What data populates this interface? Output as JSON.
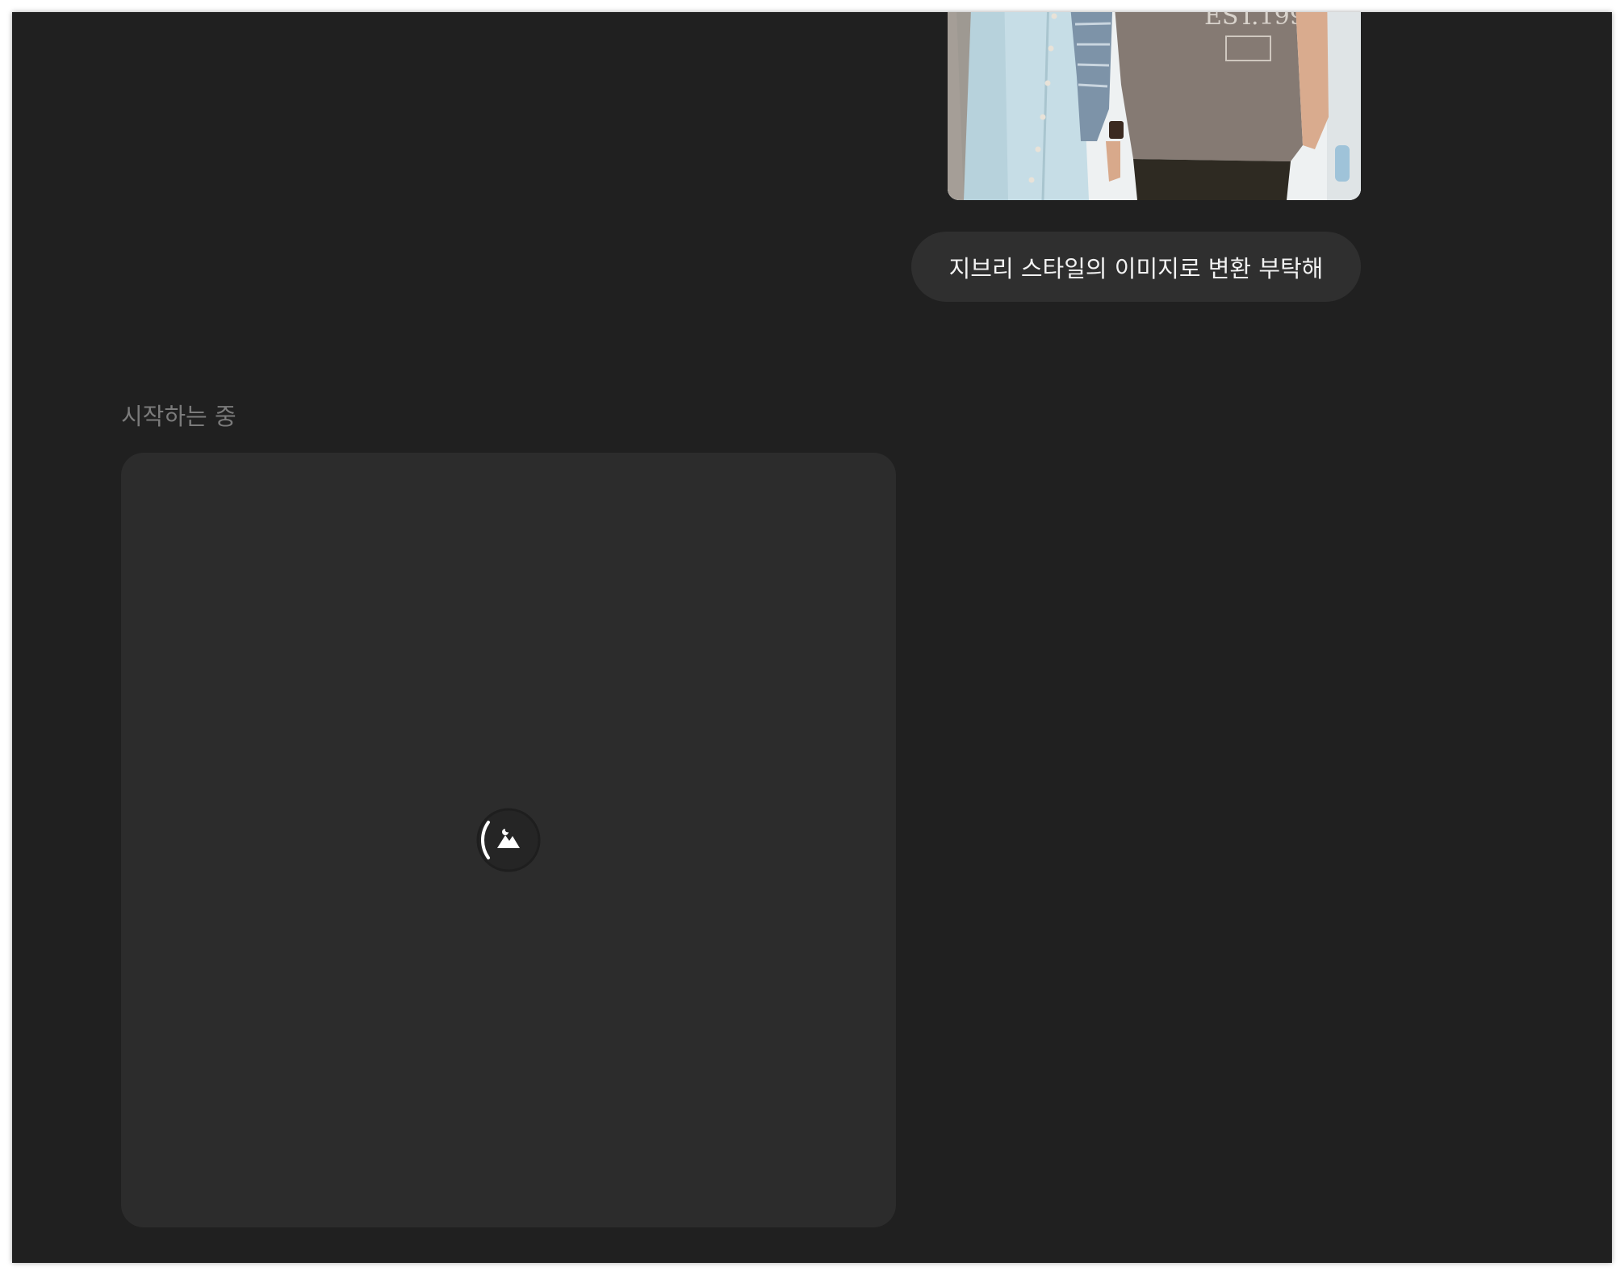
{
  "conversation": {
    "user_message": {
      "attachment_icon": "photo-thumbnail",
      "text": "지브리 스타일의 이미지로 변환 부탁해"
    },
    "assistant": {
      "status": "시작하는 중",
      "loading_icon": "image-mountain-icon"
    }
  },
  "colors": {
    "background": "#202020",
    "bubble": "#2f2f2f",
    "card": "#2c2c2c",
    "status_text": "#7b7b7b"
  }
}
